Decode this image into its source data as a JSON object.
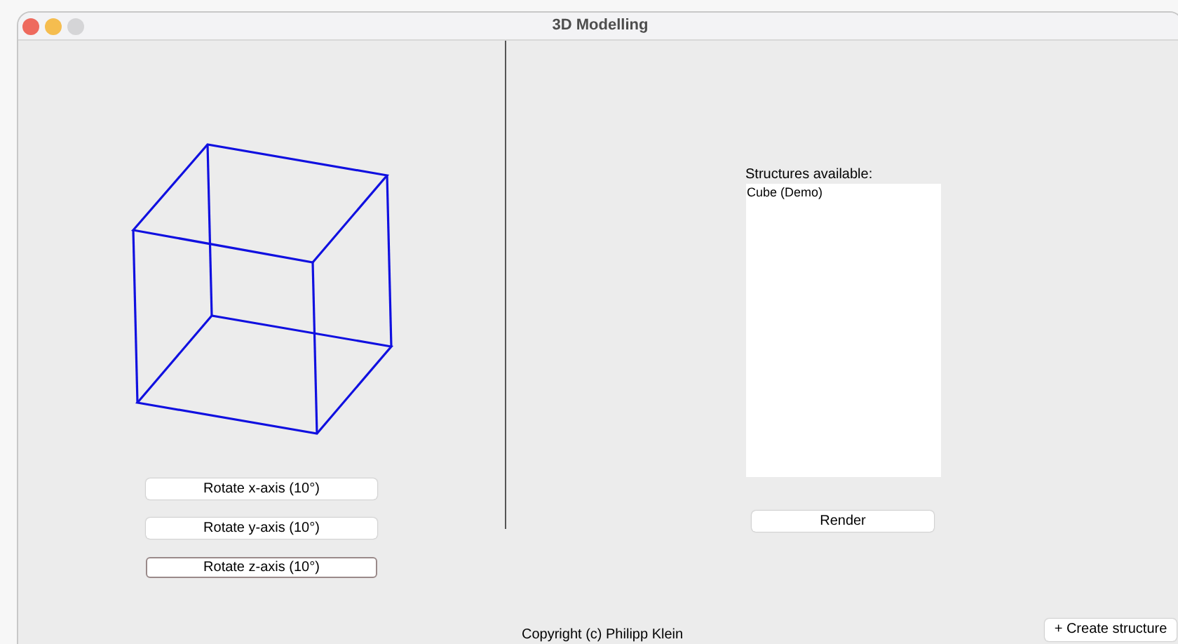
{
  "window": {
    "title": "3D Modelling"
  },
  "rotate_buttons": [
    {
      "label": "Rotate x-axis (10°)",
      "focused": false
    },
    {
      "label": "Rotate y-axis (10°)",
      "focused": false
    },
    {
      "label": "Rotate z-axis (10°)",
      "focused": true
    }
  ],
  "structures": {
    "label": "Structures available:",
    "items": [
      {
        "label": "Cube (Demo)",
        "selected": false
      }
    ]
  },
  "render_button": {
    "label": "Render"
  },
  "footer": {
    "copyright": "Copyright (c) Philipp Klein"
  },
  "create_button": {
    "label": "+ Create structure"
  }
}
